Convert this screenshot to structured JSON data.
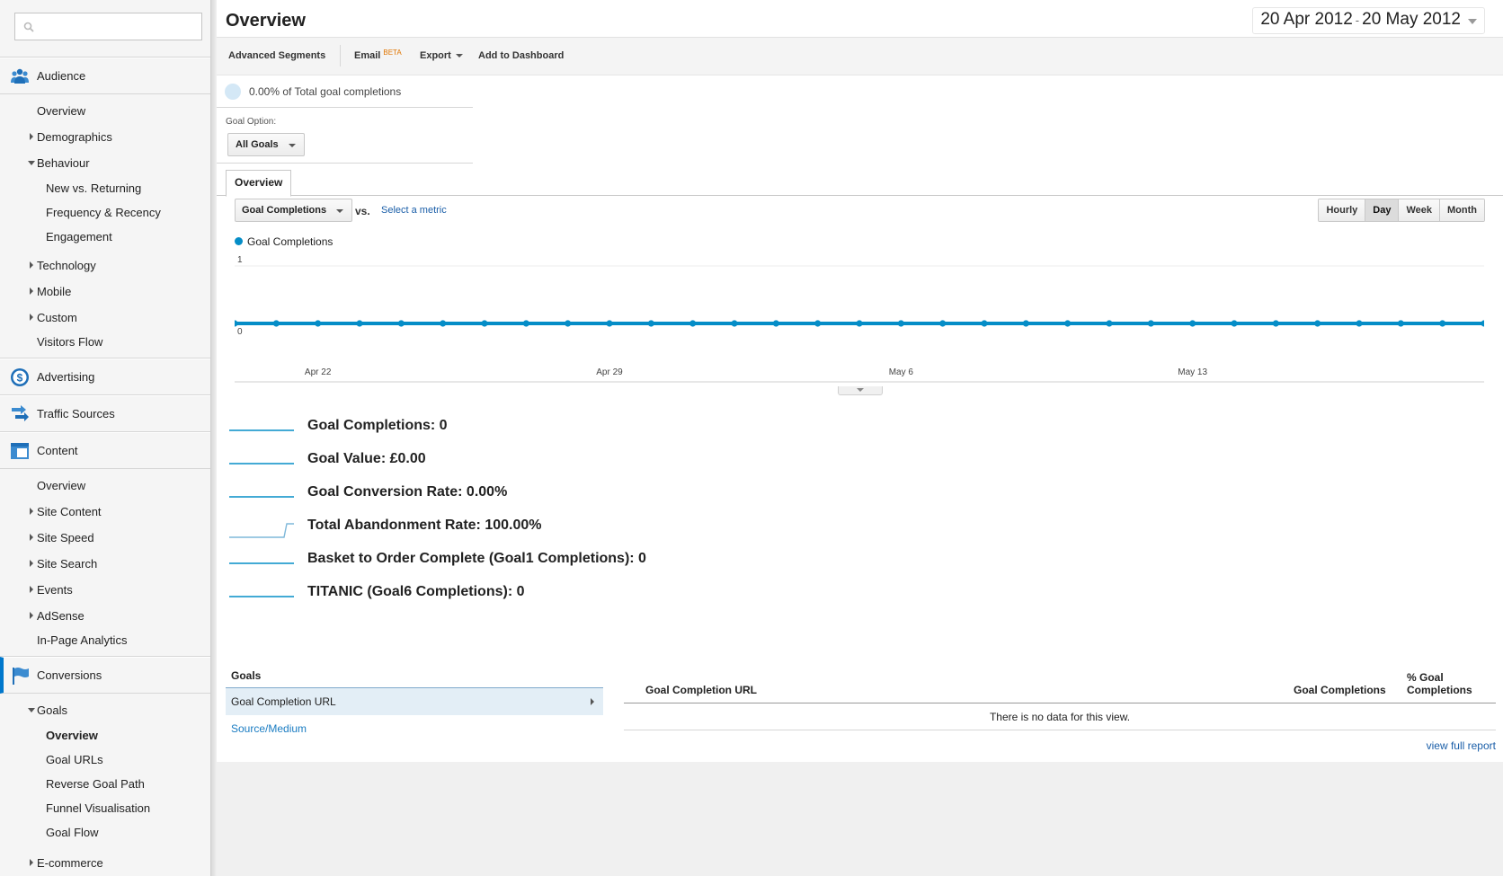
{
  "sidebar": {
    "search": {
      "value": "",
      "placeholder": ""
    },
    "audience": {
      "label": "Audience",
      "items": [
        {
          "label": "Overview"
        },
        {
          "label": "Demographics"
        },
        {
          "label": "Behaviour"
        },
        {
          "label": "New vs. Returning"
        },
        {
          "label": "Frequency & Recency"
        },
        {
          "label": "Engagement"
        },
        {
          "label": "Technology"
        },
        {
          "label": "Mobile"
        },
        {
          "label": "Custom"
        },
        {
          "label": "Visitors Flow"
        }
      ]
    },
    "advertising": {
      "label": "Advertising"
    },
    "traffic_sources": {
      "label": "Traffic Sources"
    },
    "content": {
      "label": "Content",
      "items": [
        {
          "label": "Overview"
        },
        {
          "label": "Site Content"
        },
        {
          "label": "Site Speed"
        },
        {
          "label": "Site Search"
        },
        {
          "label": "Events"
        },
        {
          "label": "AdSense"
        },
        {
          "label": "In-Page Analytics"
        }
      ]
    },
    "conversions": {
      "label": "Conversions",
      "items": [
        {
          "label": "Goals"
        },
        {
          "label": "Overview"
        },
        {
          "label": "Goal URLs"
        },
        {
          "label": "Reverse Goal Path"
        },
        {
          "label": "Funnel Visualisation"
        },
        {
          "label": "Goal Flow"
        },
        {
          "label": "E-commerce"
        }
      ]
    }
  },
  "header": {
    "title": "Overview",
    "date_start": "20 Apr 2012",
    "date_sep": "-",
    "date_end": "20 May 2012"
  },
  "toolbar": {
    "advanced_segments": "Advanced Segments",
    "email": "Email",
    "email_badge": "BETA",
    "export": "Export",
    "add_to_dashboard": "Add to Dashboard"
  },
  "summary": {
    "text": "0.00% of Total goal completions"
  },
  "goal_option": {
    "label": "Goal Option:",
    "value": "All Goals"
  },
  "tab": {
    "label": "Overview"
  },
  "metric": {
    "selected": "Goal Completions",
    "vs": "vs.",
    "select_metric": "Select a metric"
  },
  "time_buttons": [
    {
      "label": "Hourly"
    },
    {
      "label": "Day"
    },
    {
      "label": "Week"
    },
    {
      "label": "Month"
    }
  ],
  "legend": {
    "series": "Goal Completions"
  },
  "chart_data": {
    "type": "line",
    "series": [
      {
        "name": "Goal Completions",
        "values": [
          0,
          0,
          0,
          0,
          0,
          0,
          0,
          0,
          0,
          0,
          0,
          0,
          0,
          0,
          0,
          0,
          0,
          0,
          0,
          0,
          0,
          0,
          0,
          0,
          0,
          0,
          0,
          0,
          0,
          0,
          0
        ]
      }
    ],
    "x_start": "2012-04-20",
    "x_end": "2012-05-20",
    "x_tick_labels": [
      "Apr 22",
      "Apr 29",
      "May 6",
      "May 13"
    ],
    "y_tick_labels": [
      "0",
      "1"
    ],
    "ylim": [
      0,
      1
    ],
    "grid": true,
    "color": "#058dc7"
  },
  "sparklines": [
    {
      "label": "Goal Completions: 0",
      "shape": "flat"
    },
    {
      "label": "Goal Value: £0.00",
      "shape": "flat"
    },
    {
      "label": "Goal Conversion Rate: 0.00%",
      "shape": "flat"
    },
    {
      "label": "Total Abandonment Rate: 100.00%",
      "shape": "step"
    },
    {
      "label": "Basket to Order Complete (Goal1 Completions): 0",
      "shape": "flat"
    },
    {
      "label": "TITANIC (Goal6 Completions): 0",
      "shape": "flat"
    }
  ],
  "goals_panel": {
    "heading": "Goals",
    "selected": "Goal Completion URL",
    "link": "Source/Medium"
  },
  "table": {
    "col1": "Goal Completion URL",
    "col2": "Goal Completions",
    "col3a": "% Goal",
    "col3b": "Completions",
    "no_data": "There is no data for this view.",
    "view_full_report": "view full report"
  },
  "colors": {
    "accent": "#058dc7",
    "link": "#1a5ea8",
    "active_bar": "#0077cc"
  }
}
